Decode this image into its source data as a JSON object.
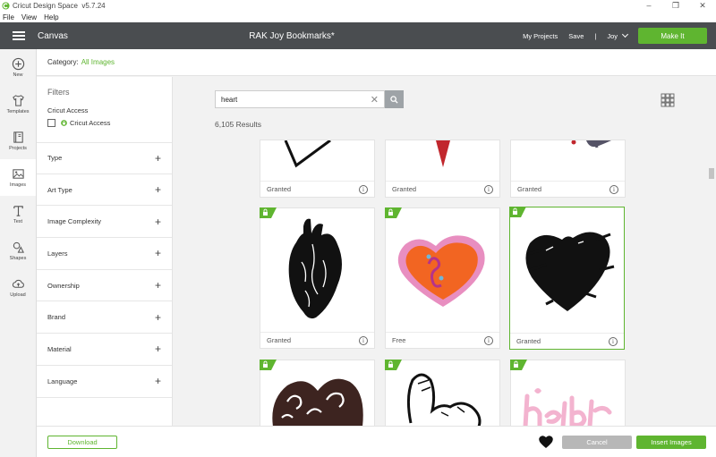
{
  "window": {
    "title": "Cricut Design Space",
    "version": "v5.7.24"
  },
  "menu": [
    "File",
    "View",
    "Help"
  ],
  "header": {
    "canvas_label": "Canvas",
    "project_title": "RAK Joy Bookmarks*",
    "my_projects": "My Projects",
    "save": "Save",
    "separator": "|",
    "user": "Joy",
    "make_it": "Make It",
    "accent_color": "#5fb530",
    "bar_color": "#4a4d50"
  },
  "rail": [
    {
      "label": "New",
      "icon": "plus-circle-icon"
    },
    {
      "label": "Templates",
      "icon": "shirt-icon"
    },
    {
      "label": "Projects",
      "icon": "projects-icon"
    },
    {
      "label": "Images",
      "icon": "image-icon"
    },
    {
      "label": "Text",
      "icon": "text-icon"
    },
    {
      "label": "Shapes",
      "icon": "shapes-icon"
    },
    {
      "label": "Upload",
      "icon": "cloud-upload-icon"
    }
  ],
  "category": {
    "label": "Category:",
    "value": "All Images"
  },
  "filters": {
    "title": "Filters",
    "access_title": "Cricut Access",
    "access_option": "Cricut Access",
    "groups": [
      "Type",
      "Art Type",
      "Image Complexity",
      "Layers",
      "Ownership",
      "Brand",
      "Material",
      "Language"
    ]
  },
  "search": {
    "value": "heart",
    "placeholder": "Search",
    "results": "6,105 Results"
  },
  "tiles": [
    {
      "label": "Granted",
      "icon": "heart-outline-partial"
    },
    {
      "label": "Granted",
      "icon": "red-drop-partial"
    },
    {
      "label": "Granted",
      "icon": "splash-partial"
    },
    {
      "label": "Granted",
      "icon": "anatomical-heart-icon",
      "access": true
    },
    {
      "label": "Free",
      "icon": "orange-swirl-heart-icon",
      "access": true
    },
    {
      "label": "Granted",
      "icon": "scribble-heart-icon",
      "access": true,
      "selected": true
    },
    {
      "label": "",
      "icon": "filigree-heart-icon",
      "access": true
    },
    {
      "label": "",
      "icon": "hand-heart-icon",
      "access": true
    },
    {
      "label": "",
      "icon": "pink-lettering-icon",
      "access": true
    }
  ],
  "bottom": {
    "download": "Download",
    "cancel": "Cancel",
    "insert": "Insert Images"
  }
}
